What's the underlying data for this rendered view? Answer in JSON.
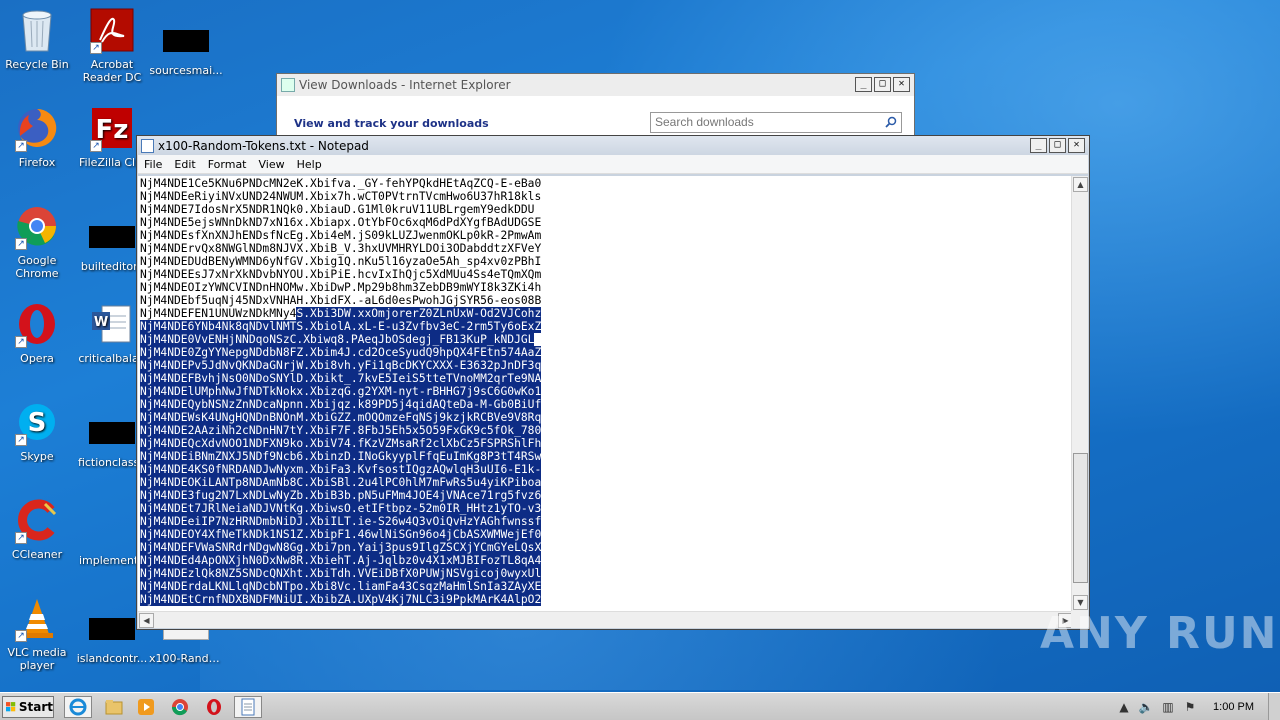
{
  "desktop": {
    "icons": [
      {
        "label": "Recycle Bin"
      },
      {
        "label": "Acrobat Reader DC"
      },
      {
        "label": "sourcesmai..."
      },
      {
        "label": "Firefox"
      },
      {
        "label": "FileZilla Clie"
      },
      {
        "label": "Google Chrome"
      },
      {
        "label": "builteditor.j"
      },
      {
        "label": "Opera"
      },
      {
        "label": "criticalbalan"
      },
      {
        "label": "Skype"
      },
      {
        "label": "fictionclasse"
      },
      {
        "label": "CCleaner"
      },
      {
        "label": "implementa"
      },
      {
        "label": "VLC media player"
      },
      {
        "label": "islandcontr..."
      },
      {
        "label": "x100-Rando..."
      }
    ]
  },
  "ie_window": {
    "title": "View Downloads - Internet Explorer",
    "heading": "View and track your downloads",
    "search_placeholder": "Search downloads"
  },
  "notepad": {
    "title": "x100-Random-Tokens.txt - Notepad",
    "menu": [
      "File",
      "Edit",
      "Format",
      "View",
      "Help"
    ],
    "lines_plain": [
      "NjM4NDE1Ce5KNu6PNDcMN2eK.Xbifva._GY-fehYPQkdHEtAqZCQ-E-eBa0",
      "NjM4NDEeRiyiNVxUND24NWUM.Xbix7h.wCT0PVtrnTVcmHwo6U37hR18kls",
      "NjM4NDE7IdosNrX5NDR1NQk0.XbiauD.G1Ml0kruV11UBLrgemY9edkDDU",
      "NjM4NDE5ejsWNnDkND7xN16x.Xbiapx.OtYbFOc6xqM6dPdXYgfBAdUDGSE",
      "NjM4NDEsfXnXNJhENDsfNcEg.Xbi4eM.jS09kLUZJwenmOKLp0kR-2PmwAm",
      "NjM4NDErvQx8NWGlNDm8NJVX.XbiB_V.3hxUVMHRYLDOi3ODabddtzXFVeY",
      "NjM4NDEDUdBENyWMND6yNfGV.Xbig1Q.nKu5l16yzaOe5Ah_sp4xv0zPBhI",
      "NjM4NDEEsJ7xNrXkNDvbNYOU.XbiPiE.hcvIxIhQjc5XdMUu4Ss4eTQmXQm",
      "NjM4NDEOIzYWNCVINDnHNOMw.XbiDwP.Mp29b8hm3ZebDB9mWYI8k3ZKi4h",
      "NjM4NDEbf5uqNj45NDxVNHAH.XbidFX.-aL6d0esPwohJGjSYR56-eos08B"
    ],
    "partial_line": {
      "plain": "NjM4NDEFEN1UNUWzNDkMNy4",
      "selected": "S.Xbi3DW.xxOmjorerZ0ZLnUxW-Od2VJCohz"
    },
    "lines_selected": [
      "NjM4NDE6YNb4Nk8qNDvlNMTS.XbiolA.xL-E-u3Zvfbv3eC-2rm5Ty6oExZ",
      "NjM4NDE0VvENHjNNDqoNSzC.Xbiwq8.PAeqJbOSdegj_FB13KuP_kNDJGL",
      "NjM4NDE0ZgYYNepgNDdbN8FZ.Xbim4J.cd2OceSyudQ9hpQX4FEtn574AaZ",
      "NjM4NDEPv5JdNvQKNDaGNrjW.Xbi8vh.yFi1qBcDKYCXXX-E3632pJnDF3q",
      "NjM4NDEFBvhjNsO0NDoSNYlD.Xbikt_.7kvE5IeiS5tteTVnoMM2qrTe9NA",
      "NjM4NDElUMphNwJfNDTkNokx.XbizqG.g2YXM-nyt-rBHHG7j9sC6G0wKo1",
      "NjM4NDEQybNSNzZnNDcaNpnn.Xbijqz.k89PD5j4qidAQteDa-M-Gb0BiUf",
      "NjM4NDEWsK4UNgHQNDnBNOnM.XbiGZZ.mOQOmzeFqNSj9kzjkRCBVe9V8Rq",
      "NjM4NDE2AAziNh2cNDnHN7tY.XbiF7F.8FbJ5Eh5x5O59FxGK9c5fOk_780",
      "NjM4NDEQcXdvNOO1NDFXN9ko.XbiV74.fKzVZMsaRf2clXbCz5FSPRShlFh",
      "NjM4NDEiBNmZNXJ5NDf9Ncb6.XbinzD.INoGkyyplFfqEuImKg8P3tT4RSw",
      "NjM4NDE4KS0fNRDANDJwNyxm.XbiFa3.KvfsostIQgzAQwlqH3uUI6-E1k-",
      "NjM4NDEOKiLANTp8NDAmNb8C.XbiSBl.2u4lPC0hlM7mFwRs5u4yiKPiboa",
      "NjM4NDE3fug2N7LxNDLwNyZb.XbiB3b.pN5uFMm4JOE4jVNAce71rg5fvz6",
      "NjM4NDEt7JRlNeiaNDJVNtKg.XbiwsO.etIFtbpz-52m0IR_HHtz1yTO-v3",
      "NjM4NDEeiIP7NzHRNDmbNiDJ.XbiILT.ie-S26w4Q3vOiQvHzYAGhfwnssf",
      "NjM4NDEOY4XfNeTkNDk1NS1Z.XbipF1.46wlNiSGn96o4jCbASXWMWejEf0",
      "NjM4NDEFVWaSNRdrNDgwN8Gg.Xbi7pn.Yaij3pus9IlgZSCXjYCmGYeLQsX",
      "NjM4NDEd4ApONXjhN0DxNw8R.XbiehT.Aj-Jqlbz0v4X1xMJBIFozTL8qA4",
      "NjM4NDEzlQk8NZ5SNDcQNXht.XbiTdh.VVEiDBfX0PUWjNSVgicoj0wyxUl",
      "NjM4NDErdaLKNLlqNDcbNTpo.Xbi8Vc.liamFa43CsqzMaHmlSnIa3ZAyXE",
      "NjM4NDEtCrnfNDXBNDFMNiUI.XbibZA.UXpV4Kj7NLC3i9PpkMArK4AlpO2"
    ]
  },
  "taskbar": {
    "start_label": "Start",
    "clock": "1:00 PM"
  },
  "watermark": "ANY RUN"
}
